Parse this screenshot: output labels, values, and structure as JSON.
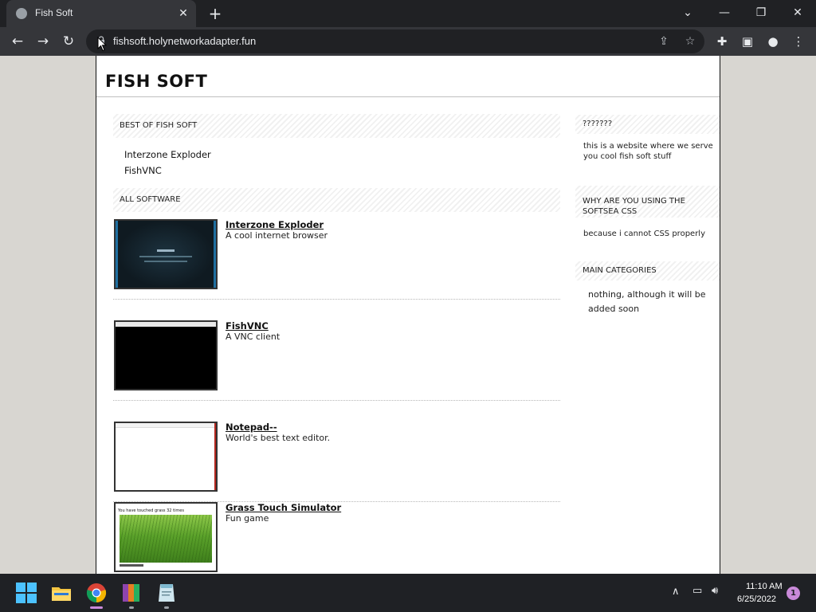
{
  "browser": {
    "tab_title": "Fish Soft",
    "tab_close": "✕",
    "new_tab": "+",
    "url": "fishsoft.holynetworkadapter.fun",
    "icons": [
      "globe-icon",
      "back-arrow-icon",
      "forward-arrow-icon",
      "reload-icon",
      "lock-icon",
      "share-icon",
      "star-icon",
      "extensions-icon",
      "side-panel-icon",
      "profile-icon",
      "menu-icon"
    ]
  },
  "site": {
    "title": "FISH SOFT",
    "best": {
      "heading": "BEST OF FISH SOFT",
      "items": [
        "Interzone Exploder",
        "FishVNC"
      ]
    },
    "all": {
      "heading": "ALL SOFTWARE",
      "items": [
        {
          "name": "Interzone Exploder",
          "desc": "A cool internet browser",
          "thumb": "dark-teal"
        },
        {
          "name": "FishVNC",
          "desc": "A VNC client",
          "thumb": "black"
        },
        {
          "name": "Notepad--",
          "desc": "World's best text editor.",
          "thumb": "white"
        },
        {
          "name": "Grass Touch Simulator",
          "desc": "Fun game",
          "thumb": "grass",
          "thumb_caption": "You have touched grass 32 times"
        }
      ]
    },
    "sidebar": [
      {
        "heading": "???????",
        "text": "this is a website where we serve you cool fish soft stuff"
      },
      {
        "heading": "WHY ARE YOU USING THE SOFTSEA CSS",
        "text": "because i cannot CSS properly"
      },
      {
        "heading": "MAIN CATEGORIES",
        "text": "nothing, although it will be added soon"
      }
    ]
  },
  "taskbar": {
    "time": "11:10 AM",
    "date": "6/25/2022",
    "notifications": "1",
    "apps": [
      "start-icon",
      "file-explorer-icon",
      "chrome-icon",
      "winrar-icon",
      "notepad-app-icon"
    ]
  }
}
